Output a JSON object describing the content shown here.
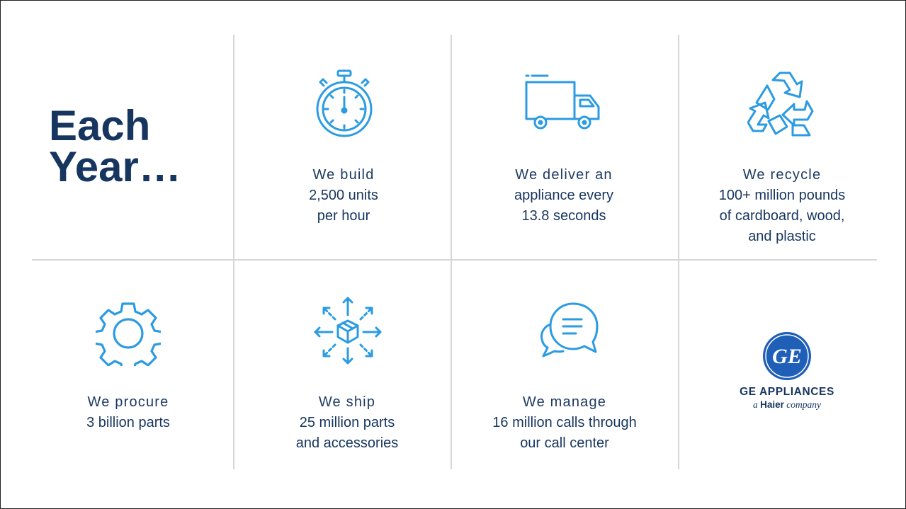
{
  "heading": {
    "line1": "Each",
    "line2": "Year…"
  },
  "cells": [
    {
      "lead": "We build",
      "lines": [
        "2,500 units",
        "per hour"
      ],
      "icon": "stopwatch-icon"
    },
    {
      "lead": "We deliver an",
      "lines": [
        "appliance every",
        "13.8 seconds"
      ],
      "icon": "delivery-truck-icon"
    },
    {
      "lead": "We recycle",
      "lines": [
        "100+ million pounds",
        "of cardboard, wood,",
        "and plastic"
      ],
      "icon": "recycle-icon"
    },
    {
      "lead": "We procure",
      "lines": [
        "3 billion parts"
      ],
      "icon": "gear-icon"
    },
    {
      "lead": "We ship",
      "lines": [
        "25 million parts",
        "and accessories"
      ],
      "icon": "shipping-box-icon"
    },
    {
      "lead": "We manage",
      "lines": [
        "16 million calls through",
        "our call center"
      ],
      "icon": "chat-bubbles-icon"
    }
  ],
  "logo": {
    "monogram": "GE",
    "name": "GE APPLIANCES",
    "tagline_prefix": "a ",
    "tagline_brand": "Haier",
    "tagline_suffix": " company"
  },
  "colors": {
    "navy": "#16355f",
    "icon_blue": "#2b9be2",
    "divider": "#d6d6d6",
    "logo_blue": "#1f5fb8"
  }
}
